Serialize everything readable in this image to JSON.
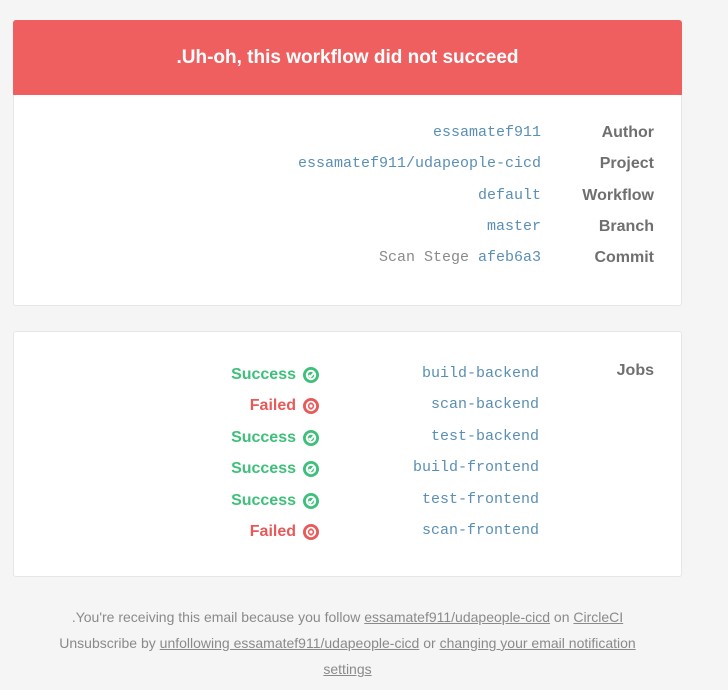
{
  "banner": {
    "title": ".Uh-oh, this workflow did not succeed"
  },
  "info": [
    {
      "value": "essamatef911",
      "label": "Author"
    },
    {
      "value": "essamatef911/udapeople-cicd",
      "label": "Project"
    },
    {
      "value": "default",
      "label": "Workflow"
    },
    {
      "value": "master",
      "label": "Branch"
    },
    {
      "value_prefix": "Scan Stege",
      "value": "afeb6a3",
      "label": "Commit"
    }
  ],
  "jobs": {
    "label": "Jobs",
    "items": [
      {
        "status": "Success",
        "name": "build-backend"
      },
      {
        "status": "Failed",
        "name": "scan-backend"
      },
      {
        "status": "Success",
        "name": "test-backend"
      },
      {
        "status": "Success",
        "name": "build-frontend"
      },
      {
        "status": "Success",
        "name": "test-frontend"
      },
      {
        "status": "Failed",
        "name": "scan-frontend"
      }
    ]
  },
  "footer": {
    "line1_prefix": ".You're receiving this email because you follow",
    "line1_link": "essamatef911/udapeople-cicd",
    "line1_mid": "on",
    "line1_link2": "CircleCI",
    "line2_prefix": "Unsubscribe by",
    "line2_link": "unfollowing essamatef911/udapeople-cicd",
    "line2_mid": "or",
    "line2_link2": "changing your email notification",
    "line3_link": "settings"
  },
  "colors": {
    "banner": "#ef5f5f",
    "success": "#3ec07a",
    "failed": "#e85a5a",
    "value": "#5a8fb5"
  }
}
